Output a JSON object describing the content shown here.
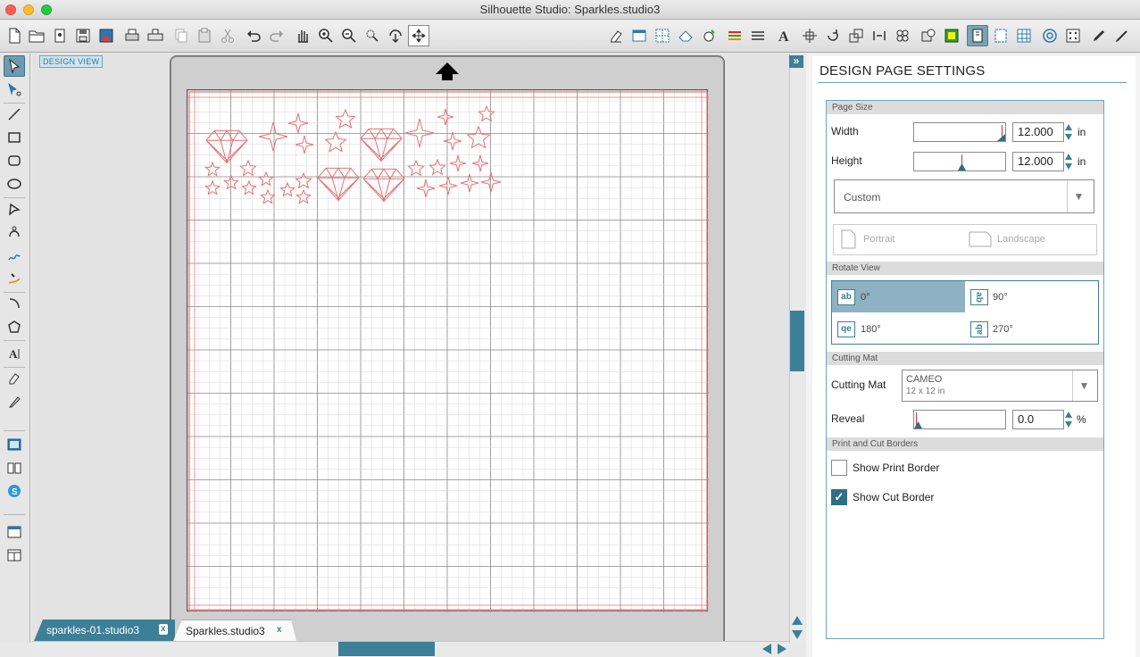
{
  "window": {
    "title": "Silhouette Studio: Sparkles.studio3"
  },
  "canvas": {
    "view_label": "DESIGN VIEW"
  },
  "tabs": [
    {
      "label": "sparkles-01.studio3",
      "close": "x"
    },
    {
      "label": "Sparkles.studio3",
      "close": "x"
    }
  ],
  "panel": {
    "title": "DESIGN PAGE SETTINGS",
    "page_size": {
      "header": "Page Size",
      "width_label": "Width",
      "width_value": "12.000",
      "height_label": "Height",
      "height_value": "12.000",
      "unit": "in",
      "preset": "Custom",
      "portrait": "Portrait",
      "landscape": "Landscape"
    },
    "rotate_view": {
      "header": "Rotate View",
      "options": [
        {
          "label": "0°",
          "glyph": "ab"
        },
        {
          "label": "90°",
          "glyph": "ab"
        },
        {
          "label": "180°",
          "glyph": "qe"
        },
        {
          "label": "270°",
          "glyph": "ab"
        }
      ],
      "selected": "0°"
    },
    "cutting_mat": {
      "header": "Cutting Mat",
      "label": "Cutting Mat",
      "mat_name": "CAMEO",
      "mat_size": "12 x 12 in",
      "reveal_label": "Reveal",
      "reveal_value": "0.0",
      "reveal_unit": "%"
    },
    "borders": {
      "header": "Print and Cut Borders",
      "print_border_label": "Show Print Border",
      "print_border_checked": false,
      "cut_border_label": "Show Cut Border",
      "cut_border_checked": true
    }
  },
  "colors": {
    "accent": "#3d7f97",
    "cut_line": "#e87070",
    "grid": "#999999"
  }
}
